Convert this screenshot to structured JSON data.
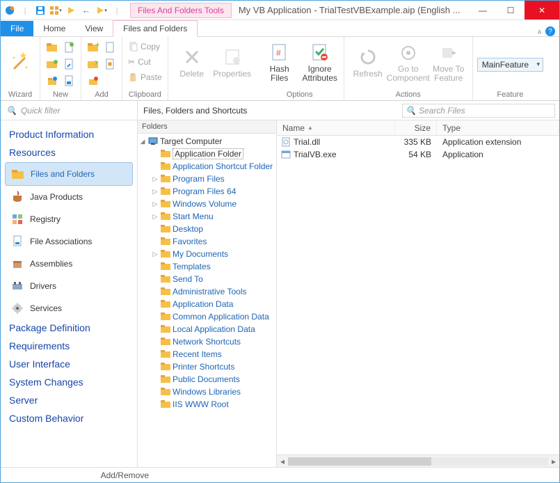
{
  "title": "My VB Application - TrialTestVBExample.aip (English ...",
  "tools_tab": "Files And Folders Tools",
  "tabs": {
    "file": "File",
    "home": "Home",
    "view": "View",
    "files": "Files and Folders"
  },
  "ribbon": {
    "wizard": "Wizard",
    "new": "New",
    "add": "Add",
    "clipboard": "Clipboard",
    "copy": "Copy",
    "cut": "Cut",
    "paste": "Paste",
    "delete": "Delete",
    "properties": "Properties",
    "hash": "Hash\nFiles",
    "ignore": "Ignore\nAttributes",
    "options": "Options",
    "refresh": "Refresh",
    "goto": "Go to\nComponent",
    "moveto": "Move To\nFeature",
    "actions": "Actions",
    "feature_label": "MainFeature",
    "feature": "Feature"
  },
  "quick_filter": "Quick filter",
  "content_title": "Files, Folders and Shortcuts",
  "search_placeholder": "Search Files",
  "nav": {
    "sections": [
      "Product Information",
      "Resources",
      "Package Definition",
      "Requirements",
      "User Interface",
      "System Changes",
      "Server",
      "Custom Behavior"
    ],
    "resources": [
      "Files and Folders",
      "Java Products",
      "Registry",
      "File Associations",
      "Assemblies",
      "Drivers",
      "Services"
    ]
  },
  "tree": {
    "header": "Folders",
    "root": "Target Computer",
    "items": [
      {
        "label": "Application Folder",
        "sel": true,
        "indent": 1,
        "exp": ""
      },
      {
        "label": "Application Shortcut Folder",
        "indent": 1,
        "exp": ""
      },
      {
        "label": "Program Files",
        "indent": 1,
        "exp": "▷"
      },
      {
        "label": "Program Files 64",
        "indent": 1,
        "exp": "▷"
      },
      {
        "label": "Windows Volume",
        "indent": 1,
        "exp": "▷"
      },
      {
        "label": "Start Menu",
        "indent": 1,
        "exp": "▷"
      },
      {
        "label": "Desktop",
        "indent": 1,
        "exp": ""
      },
      {
        "label": "Favorites",
        "indent": 1,
        "exp": ""
      },
      {
        "label": "My Documents",
        "indent": 1,
        "exp": "▷"
      },
      {
        "label": "Templates",
        "indent": 1,
        "exp": ""
      },
      {
        "label": "Send To",
        "indent": 1,
        "exp": ""
      },
      {
        "label": "Administrative Tools",
        "indent": 1,
        "exp": ""
      },
      {
        "label": "Application Data",
        "indent": 1,
        "exp": ""
      },
      {
        "label": "Common Application Data",
        "indent": 1,
        "exp": ""
      },
      {
        "label": "Local Application Data",
        "indent": 1,
        "exp": ""
      },
      {
        "label": "Network Shortcuts",
        "indent": 1,
        "exp": ""
      },
      {
        "label": "Recent Items",
        "indent": 1,
        "exp": ""
      },
      {
        "label": "Printer Shortcuts",
        "indent": 1,
        "exp": ""
      },
      {
        "label": "Public Documents",
        "indent": 1,
        "exp": ""
      },
      {
        "label": "Windows Libraries",
        "indent": 1,
        "exp": ""
      },
      {
        "label": "IIS WWW Root",
        "indent": 1,
        "exp": ""
      }
    ]
  },
  "list": {
    "cols": {
      "name": "Name",
      "size": "Size",
      "type": "Type"
    },
    "rows": [
      {
        "name": "Trial.dll",
        "size": "335 KB",
        "type": "Application extension",
        "icon": "dll"
      },
      {
        "name": "TrialVB.exe",
        "size": "54 KB",
        "type": "Application",
        "icon": "exe"
      }
    ]
  },
  "status": "Add/Remove"
}
